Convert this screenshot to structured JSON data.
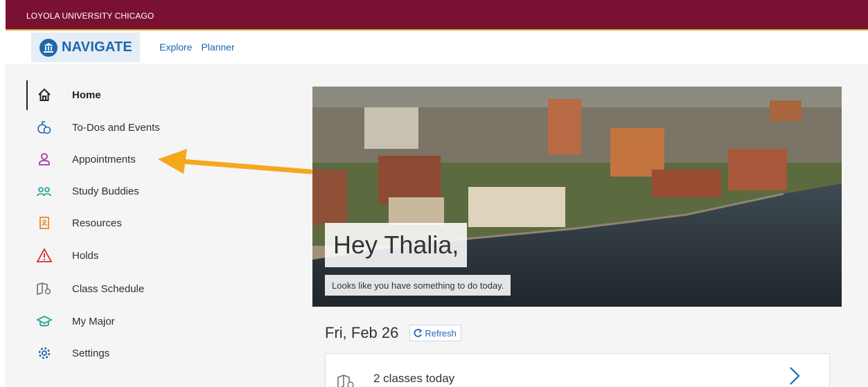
{
  "university_bar": {
    "text": "LOYOLA UNIVERSITY CHICAGO"
  },
  "header": {
    "brand": "NAVIGATE",
    "nav": [
      {
        "label": "Explore"
      },
      {
        "label": "Planner"
      }
    ]
  },
  "sidebar": {
    "items": [
      {
        "label": "Home",
        "icon": "home-icon",
        "active": true
      },
      {
        "label": "To-Dos and Events",
        "icon": "todo-events-icon"
      },
      {
        "label": "Appointments",
        "icon": "person-icon"
      },
      {
        "label": "Study Buddies",
        "icon": "study-buddies-icon"
      },
      {
        "label": "Resources",
        "icon": "resources-icon"
      },
      {
        "label": "Holds",
        "icon": "warning-icon"
      },
      {
        "label": "Class Schedule",
        "icon": "class-schedule-icon"
      },
      {
        "label": "My Major",
        "icon": "graduation-cap-icon"
      },
      {
        "label": "Settings",
        "icon": "gear-icon"
      }
    ]
  },
  "hero": {
    "greeting": "Hey Thalia,",
    "subtext": "Looks like you have something to do today."
  },
  "date": {
    "label": "Fri, Feb 26",
    "refresh_label": "Refresh"
  },
  "classes_card": {
    "text": "2 classes today"
  },
  "colors": {
    "university_maroon": "#7a1133",
    "gold": "#c8a13a",
    "navigate_blue": "#1d67b0",
    "annotation_arrow": "#f3a81e"
  }
}
